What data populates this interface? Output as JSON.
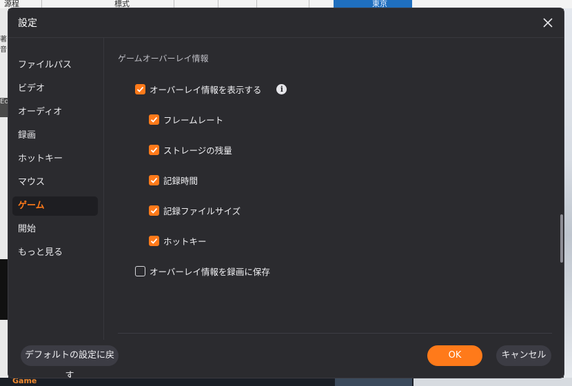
{
  "background_app": {
    "toolbar_text_1": "源程",
    "toolbar_text_2": "標式",
    "toolbar_text_3": "東京",
    "left_text": "著音",
    "left_text_2": "Eo",
    "bottom_text": "Game"
  },
  "dialog": {
    "title": "設定",
    "sidebar": {
      "items": [
        {
          "label": "ファイルパス",
          "active": false
        },
        {
          "label": "ビデオ",
          "active": false
        },
        {
          "label": "オーディオ",
          "active": false
        },
        {
          "label": "録画",
          "active": false
        },
        {
          "label": "ホットキー",
          "active": false
        },
        {
          "label": "マウス",
          "active": false
        },
        {
          "label": "ゲーム",
          "active": true
        },
        {
          "label": "開始",
          "active": false
        },
        {
          "label": "もっと見る",
          "active": false
        }
      ]
    },
    "content": {
      "section_title": "ゲームオーバーレイ情報",
      "show_overlay": {
        "label": "オーバーレイ情報を表示する",
        "checked": true
      },
      "info_icon_glyph": "i",
      "sub_options": [
        {
          "label": "フレームレート",
          "checked": true
        },
        {
          "label": "ストレージの残量",
          "checked": true
        },
        {
          "label": "記録時間",
          "checked": true
        },
        {
          "label": "記録ファイルサイズ",
          "checked": true
        },
        {
          "label": "ホットキー",
          "checked": true
        }
      ],
      "save_overlay": {
        "label": "オーバーレイ情報を録画に保存",
        "checked": false
      }
    },
    "footer": {
      "default_label": "デフォルトの設定に戻す",
      "ok_label": "OK",
      "cancel_label": "キャンセル"
    }
  },
  "colors": {
    "accent": "#ff7a1a",
    "dialog_bg": "#2b2b2f",
    "active_item_bg": "#1e1e22"
  },
  "icons": {
    "close": "close-icon",
    "check": "check-icon",
    "info": "info-icon"
  }
}
